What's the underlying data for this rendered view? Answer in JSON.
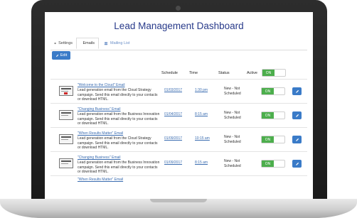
{
  "page": {
    "title": "Lead Management Dashboard"
  },
  "tabs": [
    {
      "label": "Settings",
      "icon": "gear-icon"
    },
    {
      "label": "Emails",
      "icon": "email-icon"
    },
    {
      "label": "Mailing List",
      "icon": "users-icon"
    }
  ],
  "toolbar": {
    "edit_label": "Edit",
    "edit_icon": "pencil-icon"
  },
  "table": {
    "columns": {
      "schedule": "Schedule",
      "time": "Time",
      "status": "Status",
      "active": "Active"
    },
    "active_toggle_label": "ON",
    "rows": [
      {
        "name": "\"Welcome to the Cloud\" Email",
        "description": "Lead generation email from the Cloud Strategy campaign. Send this email directly to your contacts or download HTML.",
        "schedule": "01/03/2017",
        "time": "1:30 pm",
        "status": "New - Not Scheduled",
        "toggle": "ON",
        "thumbnail": "email-template-thumbnail-red"
      },
      {
        "name": "\"Changing Business\" Email",
        "description": "Lead generation email from the Business Innovation campaign. Send this email directly to your contacts or download HTML.",
        "schedule": "01/04/2017",
        "time": "8:15 am",
        "status": "New - Not Scheduled",
        "toggle": "ON",
        "thumbnail": "email-template-thumbnail"
      },
      {
        "name": "\"When Results Matter\" Email",
        "description": "Lead generation email from the Cloud Strategy campaign. Send this email directly to your contacts or download HTML.",
        "schedule": "01/09/2017",
        "time": "10:15 am",
        "status": "New - Not Scheduled",
        "toggle": "ON",
        "thumbnail": "email-template-thumbnail"
      },
      {
        "name": "\"Changing Business\" Email",
        "description": "Lead generation email from the Business Innovation campaign. Send this email directly to your contacts or download HTML.",
        "schedule": "01/09/2017",
        "time": "8:15 am",
        "status": "New - Not Scheduled",
        "toggle": "ON",
        "thumbnail": "email-template-thumbnail"
      },
      {
        "name": "\"When Results Matter\" Email",
        "description": "",
        "schedule": "",
        "time": "",
        "status": "",
        "toggle": "",
        "thumbnail": ""
      }
    ]
  },
  "colors": {
    "accent": "#3a7bc8",
    "title": "#283a8a",
    "on": "#4cae4c",
    "link": "#3a6cb0"
  }
}
